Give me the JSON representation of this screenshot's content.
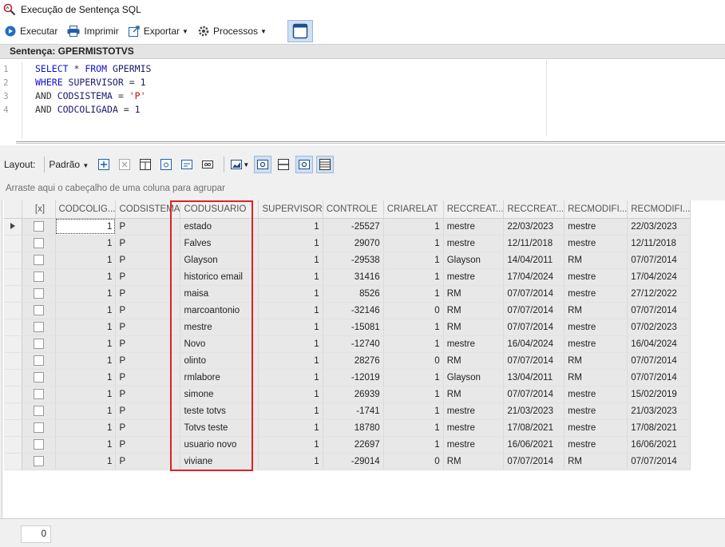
{
  "window": {
    "title": "Execução de Sentença SQL"
  },
  "toolbar": {
    "execute_label": "Executar",
    "print_label": "Imprimir",
    "export_label": "Exportar",
    "process_label": "Processos"
  },
  "sentence": {
    "header": "Sentença: GPERMISTOTVS",
    "line_numbers": [
      "1",
      "2",
      "3",
      "4"
    ],
    "lines": [
      [
        {
          "t": "SELECT",
          "c": "kw"
        },
        {
          "t": " * ",
          "c": "op"
        },
        {
          "t": "FROM",
          "c": "kw"
        },
        {
          "t": " GPERMIS",
          "c": "id"
        }
      ],
      [
        {
          "t": "WHERE",
          "c": "kw"
        },
        {
          "t": " SUPERVISOR ",
          "c": "id"
        },
        {
          "t": "=",
          "c": "op"
        },
        {
          "t": " 1",
          "c": "num"
        }
      ],
      [
        {
          "t": "AND",
          "c": "op"
        },
        {
          "t": " CODSISTEMA ",
          "c": "id"
        },
        {
          "t": "=",
          "c": "op"
        },
        {
          "t": " 'P'",
          "c": "str"
        }
      ],
      [
        {
          "t": "AND",
          "c": "op"
        },
        {
          "t": " CODCOLIGADA ",
          "c": "id"
        },
        {
          "t": "=",
          "c": "op"
        },
        {
          "t": " 1",
          "c": "num"
        }
      ]
    ]
  },
  "layout_bar": {
    "label": "Layout:",
    "dropdown_value": "Padrão"
  },
  "group_panel": {
    "hint": "Arraste aqui o cabeçalho de uma coluna para agrupar"
  },
  "grid": {
    "columns": [
      "[x]",
      "CODCOLIG...",
      "CODSISTEMA",
      "CODUSUARIO",
      "SUPERVISOR",
      "CONTROLE",
      "CRIARELAT",
      "RECCREAT...",
      "RECCREAT...",
      "RECMODIFI...",
      "RECMODIFI..."
    ],
    "rows": [
      [
        "1",
        "P",
        "estado",
        "1",
        "-25527",
        "1",
        "mestre",
        "22/03/2023",
        "mestre",
        "22/03/2023"
      ],
      [
        "1",
        "P",
        "Falves",
        "1",
        "29070",
        "1",
        "mestre",
        "12/11/2018",
        "mestre",
        "12/11/2018"
      ],
      [
        "1",
        "P",
        "Glayson",
        "1",
        "-29538",
        "1",
        "Glayson",
        "14/04/2011",
        "RM",
        "07/07/2014"
      ],
      [
        "1",
        "P",
        "historico email",
        "1",
        "31416",
        "1",
        "mestre",
        "17/04/2024",
        "mestre",
        "17/04/2024"
      ],
      [
        "1",
        "P",
        "maisa",
        "1",
        "8526",
        "1",
        "RM",
        "07/07/2014",
        "mestre",
        "27/12/2022"
      ],
      [
        "1",
        "P",
        "marcoantonio",
        "1",
        "-32146",
        "0",
        "RM",
        "07/07/2014",
        "RM",
        "07/07/2014"
      ],
      [
        "1",
        "P",
        "mestre",
        "1",
        "-15081",
        "1",
        "RM",
        "07/07/2014",
        "mestre",
        "07/02/2023"
      ],
      [
        "1",
        "P",
        "Novo",
        "1",
        "-12740",
        "1",
        "mestre",
        "16/04/2024",
        "mestre",
        "16/04/2024"
      ],
      [
        "1",
        "P",
        "olinto",
        "1",
        "28276",
        "0",
        "RM",
        "07/07/2014",
        "RM",
        "07/07/2014"
      ],
      [
        "1",
        "P",
        "rmlabore",
        "1",
        "-12019",
        "1",
        "Glayson",
        "13/04/2011",
        "RM",
        "07/07/2014"
      ],
      [
        "1",
        "P",
        "simone",
        "1",
        "26939",
        "1",
        "RM",
        "07/07/2014",
        "mestre",
        "15/02/2019"
      ],
      [
        "1",
        "P",
        "teste totvs",
        "1",
        "-1741",
        "1",
        "mestre",
        "21/03/2023",
        "mestre",
        "21/03/2023"
      ],
      [
        "1",
        "P",
        "Totvs teste",
        "1",
        "18780",
        "1",
        "mestre",
        "17/08/2021",
        "mestre",
        "17/08/2021"
      ],
      [
        "1",
        "P",
        "usuario novo",
        "1",
        "22697",
        "1",
        "mestre",
        "16/06/2021",
        "mestre",
        "16/06/2021"
      ],
      [
        "1",
        "P",
        "viviane",
        "1",
        "-29014",
        "0",
        "RM",
        "07/07/2014",
        "RM",
        "07/07/2014"
      ]
    ]
  },
  "footer": {
    "record_count": "0"
  },
  "colors": {
    "highlight": "#e02020",
    "keyword": "#1010d0",
    "string": "#c01010"
  }
}
